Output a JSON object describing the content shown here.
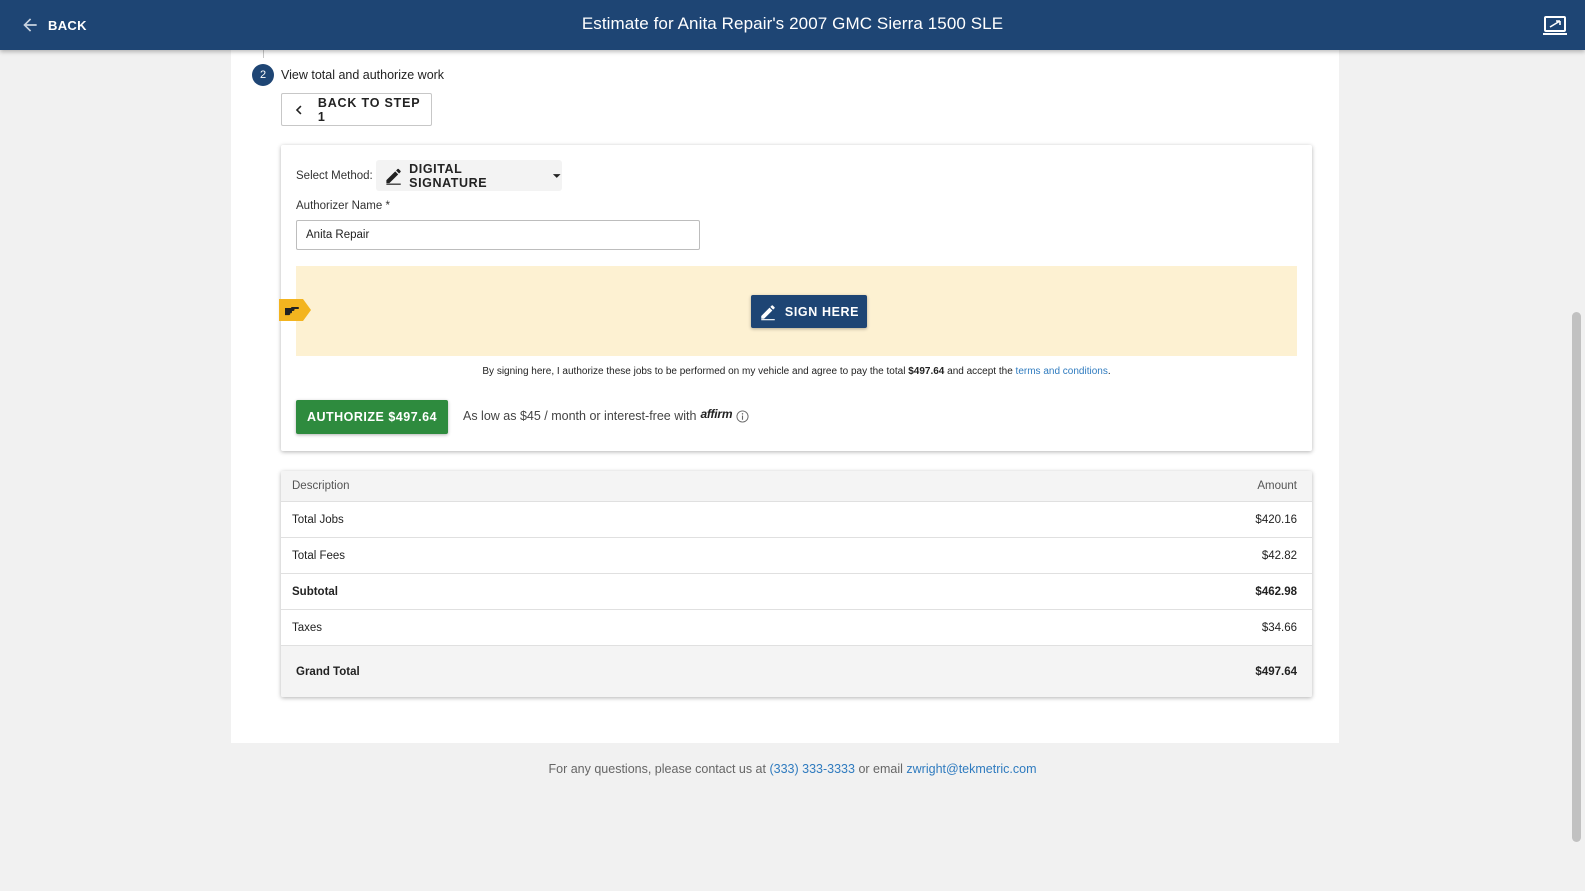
{
  "header": {
    "back_label": "BACK",
    "title": "Estimate for Anita Repair's 2007 GMC Sierra 1500 SLE"
  },
  "step": {
    "number": "2",
    "label": "View total and authorize work",
    "back_button_label": "BACK TO STEP 1"
  },
  "authorization": {
    "method_label": "Select Method:",
    "method_value": "DIGITAL SIGNATURE",
    "name_label": "Authorizer Name *",
    "name_value": "Anita Repair",
    "sign_button_label": "SIGN HERE",
    "consent_prefix": "By signing here, I authorize these jobs to be performed on my vehicle and agree to pay the total",
    "consent_amount": "$497.64",
    "consent_middle": "and accept the",
    "consent_link": "terms and conditions",
    "consent_suffix": ".",
    "authorize_button_label": "AUTHORIZE $497.64",
    "financing_text": "As low as $45 / month or interest-free with",
    "financing_brand": "affirm"
  },
  "summary": {
    "headers": {
      "description": "Description",
      "amount": "Amount"
    },
    "rows": [
      {
        "description": "Total Jobs",
        "amount": "$420.16"
      },
      {
        "description": "Total Fees",
        "amount": "$42.82"
      },
      {
        "description": "Subtotal",
        "amount": "$462.98"
      },
      {
        "description": "Taxes",
        "amount": "$34.66"
      }
    ],
    "grand_total": {
      "description": "Grand Total",
      "amount": "$497.64"
    }
  },
  "footer": {
    "text": "For any questions, please contact us at",
    "phone": "(333) 333-3333",
    "middle": "or email",
    "email": "zwright@tekmetric.com"
  },
  "colors": {
    "header_bg": "#1e4574",
    "authorize_green": "#2e8b3e",
    "sign_area_bg": "#fdf1d2",
    "link_blue": "#2f7bbf"
  }
}
